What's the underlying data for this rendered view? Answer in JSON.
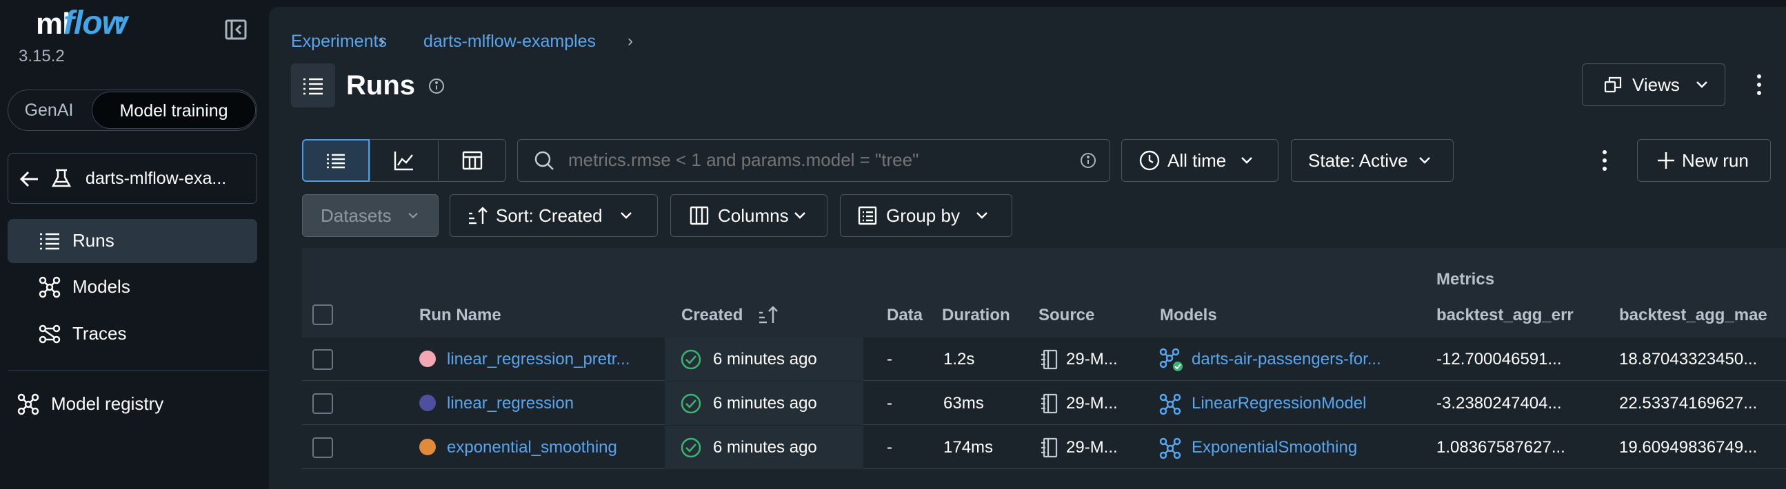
{
  "app": {
    "logo_ml": "ml",
    "logo_flow": "flow",
    "version": "3.15.2"
  },
  "mode_switch": {
    "genai": "GenAI",
    "training": "Model training"
  },
  "experiment": {
    "name": "darts-mlflow-exa..."
  },
  "nav": {
    "runs": "Runs",
    "models": "Models",
    "traces": "Traces",
    "registry": "Model registry"
  },
  "breadcrumb": {
    "experiments": "Experiments",
    "experiment": "darts-mlflow-examples",
    "sep": "›"
  },
  "page": {
    "title": "Runs",
    "views_label": "Views"
  },
  "toolbar": {
    "search_placeholder": "metrics.rmse < 1 and params.model = \"tree\"",
    "time_filter": "All time",
    "state_filter": "State: Active",
    "new_run": "New run",
    "datasets": "Datasets",
    "sort": "Sort: Created",
    "columns": "Columns",
    "group_by": "Group by"
  },
  "table": {
    "group_header": "Metrics",
    "columns": {
      "run_name": "Run Name",
      "created": "Created",
      "data": "Data",
      "duration": "Duration",
      "source": "Source",
      "models": "Models",
      "metric1": "backtest_agg_err",
      "metric2": "backtest_agg_mae"
    },
    "rows": [
      {
        "color": "#f4a6b3",
        "name": "linear_regression_pretr...",
        "created": "6 minutes ago",
        "data": "-",
        "duration": "1.2s",
        "source": "29-M...",
        "model": "darts-air-passengers-for...",
        "metric1": "-12.700046591...",
        "metric2": "18.87043323450..."
      },
      {
        "color": "#4f4fa0",
        "name": "linear_regression",
        "created": "6 minutes ago",
        "data": "-",
        "duration": "63ms",
        "source": "29-M...",
        "model": "LinearRegressionModel",
        "metric1": "-3.2380247404...",
        "metric2": "22.53374169627..."
      },
      {
        "color": "#e08a3c",
        "name": "exponential_smoothing",
        "created": "6 minutes ago",
        "data": "-",
        "duration": "174ms",
        "source": "29-M...",
        "model": "ExponentialSmoothing",
        "metric1": "1.08367587627...",
        "metric2": "19.60949836749..."
      }
    ]
  },
  "colors": {
    "background": "#11171c",
    "panel": "#1b232b",
    "link": "#5aa6ee",
    "success": "#3cb371"
  }
}
